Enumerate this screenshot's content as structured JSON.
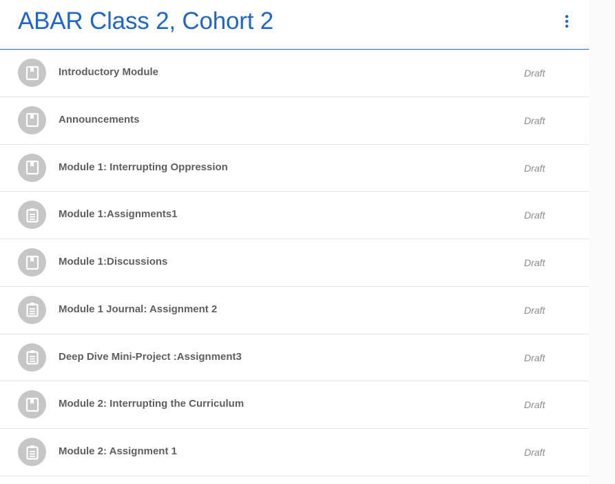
{
  "header": {
    "title": "ABAR Class 2, Cohort 2",
    "more_icon": "more-vertical-icon",
    "accent_color": "#1f66c8"
  },
  "topics": [
    {
      "title": "Introductory Module",
      "status": "Draft",
      "icon": "material-icon"
    },
    {
      "title": "Announcements",
      "status": "Draft",
      "icon": "material-icon"
    },
    {
      "title": "Module 1: Interrupting Oppression",
      "status": "Draft",
      "icon": "material-icon"
    },
    {
      "title": "Module 1:Assignments1",
      "status": "Draft",
      "icon": "assignment-icon"
    },
    {
      "title": "Module 1:Discussions",
      "status": "Draft",
      "icon": "material-icon"
    },
    {
      "title": "Module 1 Journal: Assignment 2",
      "status": "Draft",
      "icon": "assignment-icon"
    },
    {
      "title": "Deep Dive Mini-Project :Assignment3",
      "status": "Draft",
      "icon": "assignment-icon"
    },
    {
      "title": "Module 2: Interrupting the Curriculum",
      "status": "Draft",
      "icon": "material-icon"
    },
    {
      "title": "Module 2: Assignment 1",
      "status": "Draft",
      "icon": "assignment-icon"
    }
  ]
}
